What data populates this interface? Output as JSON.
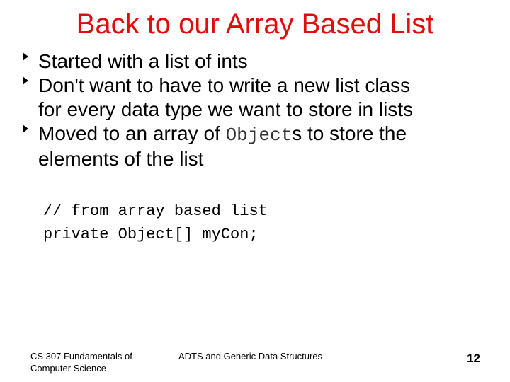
{
  "slide": {
    "title": "Back to our Array Based List",
    "bullets": [
      {
        "text": "Started with a list of ints"
      },
      {
        "line1": "Don't want to have to write a new list class",
        "line2": "for every data type we want to store in lists"
      },
      {
        "prefix": "Moved to an array of ",
        "code": "Object",
        "suffix": "s to store the",
        "line2": "elements of the list"
      }
    ],
    "code_lines": [
      "// from array based list",
      "private Object[] myCon;"
    ],
    "footer": {
      "left_line1": "CS 307 Fundamentals of",
      "left_line2": "Computer Science",
      "center": "ADTS and Generic Data Structures",
      "page_number": "12"
    },
    "colors": {
      "title": "#e00d0d",
      "text": "#000000"
    }
  }
}
